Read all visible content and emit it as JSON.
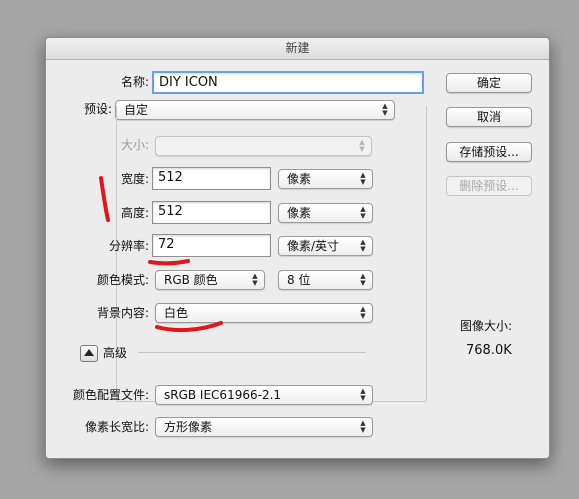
{
  "dialog": {
    "title": "新建"
  },
  "name": {
    "label": "名称:",
    "value": "DIY ICON"
  },
  "preset": {
    "label": "预设:",
    "value": "自定"
  },
  "size": {
    "label": "大小:",
    "value": ""
  },
  "width": {
    "label": "宽度:",
    "value": "512",
    "unit": "像素"
  },
  "height": {
    "label": "高度:",
    "value": "512",
    "unit": "像素"
  },
  "resolution": {
    "label": "分辨率:",
    "value": "72",
    "unit": "像素/英寸"
  },
  "color_mode": {
    "label": "颜色模式:",
    "value": "RGB 颜色",
    "depth": "8 位"
  },
  "background": {
    "label": "背景内容:",
    "value": "白色"
  },
  "advanced": {
    "label": "高级"
  },
  "color_profile": {
    "label": "颜色配置文件:",
    "value": "sRGB IEC61966-2.1"
  },
  "pixel_aspect": {
    "label": "像素长宽比:",
    "value": "方形像素"
  },
  "buttons": {
    "ok": "确定",
    "cancel": "取消",
    "save_preset": "存储预设...",
    "delete_preset": "删除预设..."
  },
  "image_size": {
    "label": "图像大小:",
    "value": "768.0K"
  },
  "colors": {
    "annotation": "#e0161c",
    "dialog_bg": "#ececec"
  }
}
